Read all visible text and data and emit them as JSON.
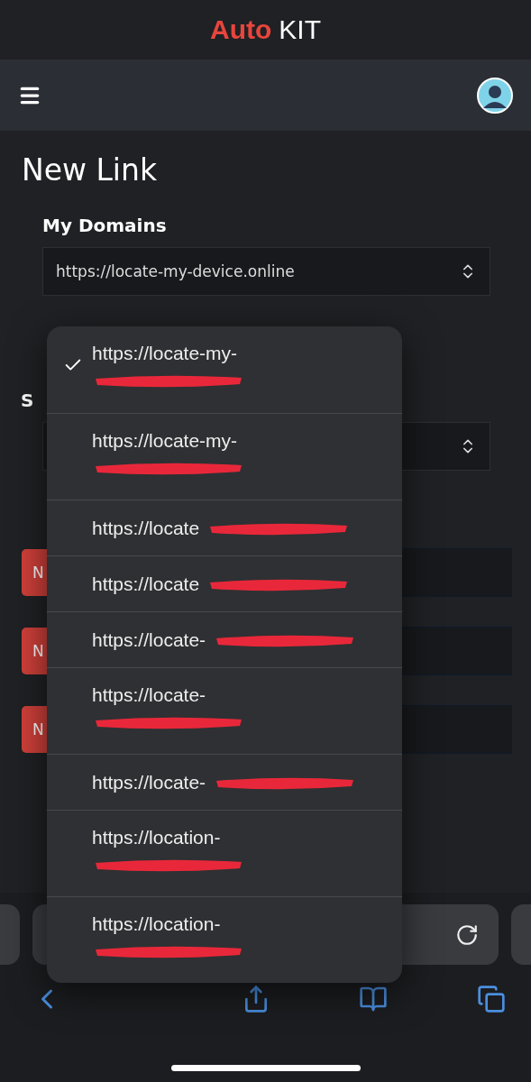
{
  "brand": {
    "accent": "Auto",
    "rest": "KIT"
  },
  "page_title": "New Link",
  "domains_field": {
    "label": "My Domains",
    "value": "https://locate-my-device.online"
  },
  "second_field": {
    "label": "S"
  },
  "row_buttons": [
    "N",
    "N",
    "N"
  ],
  "dropdown": [
    {
      "text": "https://locate-my-",
      "kind": "wrapped",
      "selected": true
    },
    {
      "text": "https://locate-my-",
      "kind": "wrapped",
      "selected": false
    },
    {
      "text": "https://locate",
      "kind": "single",
      "selected": false
    },
    {
      "text": "https://locate",
      "kind": "single",
      "selected": false
    },
    {
      "text": "https://locate-",
      "kind": "single",
      "selected": false
    },
    {
      "text": "https://locate-",
      "kind": "wrapped",
      "selected": false
    },
    {
      "text": "https://locate-",
      "kind": "single",
      "selected": false
    },
    {
      "text": "https://location-",
      "kind": "wrapped",
      "selected": false
    },
    {
      "text": "https://location-",
      "kind": "wrapped",
      "selected": false
    }
  ]
}
